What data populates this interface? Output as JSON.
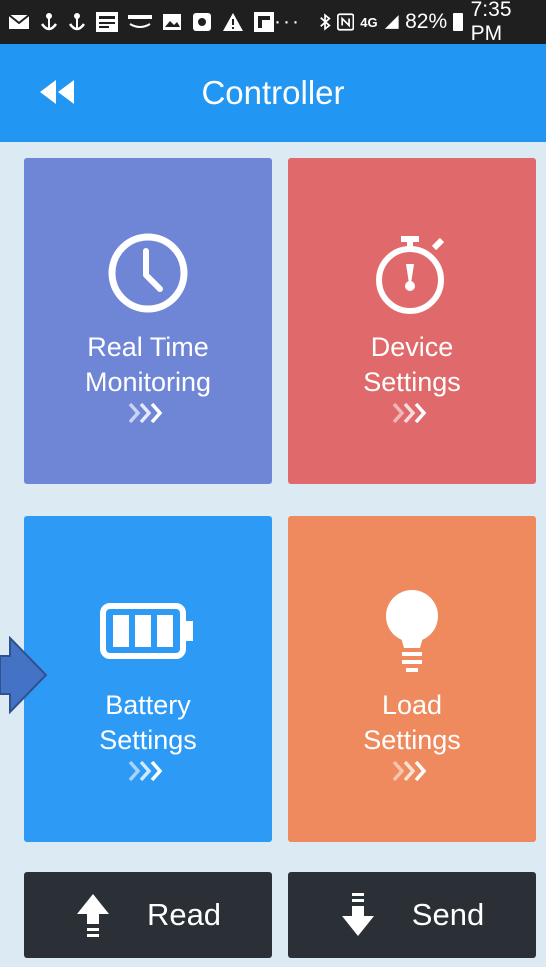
{
  "status_bar": {
    "battery_percent": "82%",
    "time": "7:35 PM",
    "network": "4G"
  },
  "app_bar": {
    "title": "Controller"
  },
  "tiles": [
    {
      "label": "Real Time\nMonitoring",
      "color": "#6f86d6",
      "icon": "clock-icon"
    },
    {
      "label": "Device\nSettings",
      "color": "#e06a6b",
      "icon": "stopwatch-icon"
    },
    {
      "label": "Battery\nSettings",
      "color": "#2d9bf5",
      "icon": "battery-icon"
    },
    {
      "label": "Load\nSettings",
      "color": "#ef8a5e",
      "icon": "lightbulb-icon"
    }
  ],
  "bottom_buttons": {
    "read_label": "Read",
    "send_label": "Send"
  },
  "colors": {
    "app_bar": "#2196f3",
    "background": "#dceaf4",
    "bottom_button": "#2b3037",
    "status_bar": "#1f1f1f"
  }
}
